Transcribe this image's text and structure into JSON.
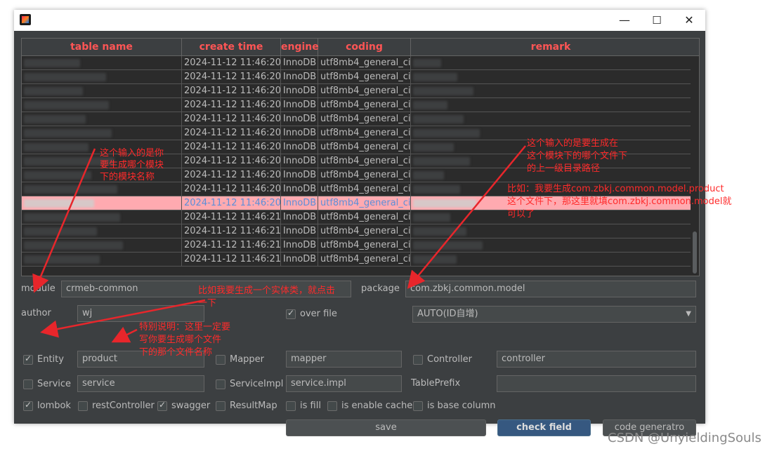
{
  "window": {
    "minimize": "—",
    "maximize": "☐",
    "close": "✕"
  },
  "table": {
    "columns": [
      "table name",
      "create time",
      "engine",
      "coding",
      "remark"
    ],
    "rows": [
      {
        "create_time": "2024-11-12 11:46:20",
        "engine": "InnoDB",
        "coding": "utf8mb4_general_ci"
      },
      {
        "create_time": "2024-11-12 11:46:20",
        "engine": "InnoDB",
        "coding": "utf8mb4_general_ci"
      },
      {
        "create_time": "2024-11-12 11:46:20",
        "engine": "InnoDB",
        "coding": "utf8mb4_general_ci"
      },
      {
        "create_time": "2024-11-12 11:46:20",
        "engine": "InnoDB",
        "coding": "utf8mb4_general_ci"
      },
      {
        "create_time": "2024-11-12 11:46:20",
        "engine": "InnoDB",
        "coding": "utf8mb4_general_ci"
      },
      {
        "create_time": "2024-11-12 11:46:20",
        "engine": "InnoDB",
        "coding": "utf8mb4_general_ci"
      },
      {
        "create_time": "2024-11-12 11:46:20",
        "engine": "InnoDB",
        "coding": "utf8mb4_general_ci"
      },
      {
        "create_time": "2024-11-12 11:46:20",
        "engine": "InnoDB",
        "coding": "utf8mb4_general_ci"
      },
      {
        "create_time": "2024-11-12 11:46:20",
        "engine": "InnoDB",
        "coding": "utf8mb4_general_ci"
      },
      {
        "create_time": "2024-11-12 11:46:20",
        "engine": "InnoDB",
        "coding": "utf8mb4_general_ci"
      },
      {
        "create_time": "2024-11-12 11:46:20",
        "engine": "InnoDB",
        "coding": "utf8mb4_general_ci"
      },
      {
        "create_time": "2024-11-12 11:46:21",
        "engine": "InnoDB",
        "coding": "utf8mb4_general_ci"
      },
      {
        "create_time": "2024-11-12 11:46:21",
        "engine": "InnoDB",
        "coding": "utf8mb4_general_ci"
      },
      {
        "create_time": "2024-11-12 11:46:21",
        "engine": "InnoDB",
        "coding": "utf8mb4_general_ci"
      },
      {
        "create_time": "2024-11-12 11:46:21",
        "engine": "InnoDB",
        "coding": "utf8mb4_general_ci"
      }
    ]
  },
  "form": {
    "module_label": "module",
    "module_value": "crmeb-common",
    "package_label": "package",
    "package_value": "com.zbkj.common.model",
    "author_label": "author",
    "author_value": "wj",
    "over_file_label": "over file",
    "id_type_value": "AUTO(ID自增)",
    "entity_label": "Entity",
    "entity_value": "product",
    "mapper_label": "Mapper",
    "mapper_value": "mapper",
    "controller_label": "Controller",
    "controller_value": "controller",
    "service_label": "Service",
    "service_value": "service",
    "serviceimpl_label": "ServiceImpl",
    "serviceimpl_value": "service.impl",
    "tableprefix_label": "TablePrefix",
    "tableprefix_value": "",
    "lombok_label": "lombok",
    "restcontroller_label": "restController",
    "swagger_label": "swagger",
    "resultmap_label": "ResultMap",
    "isfill_label": "is fill",
    "isenablecache_label": "is enable cache",
    "isbasecolumn_label": "is base column",
    "save_label": "save",
    "checkfield_label": "check field",
    "codegen_label": "code generatro"
  },
  "annotations": {
    "module_note_1": "这个输入的是你",
    "module_note_2": "要生成哪个模块",
    "module_note_3": "下的模块名称",
    "package_note_1": "这个输入的是要生成在",
    "package_note_2": "这个模块下的哪个文件下",
    "package_note_3": "的上一级目录路径",
    "example_note_1": "比如：我要生成com.zbkj.common.model.product",
    "example_note_2": "这个文件下，那这里就填com.zbkj.common.model就",
    "example_note_3": "可以了",
    "entity_click_note_1": "比如我要生成一个实体类，就点击",
    "entity_click_note_2": "一下",
    "entity_value_note_1": "特别说明：这里一定要",
    "entity_value_note_2": "写你要生成哪个文件",
    "entity_value_note_3": "下的那个文件名称"
  },
  "watermark": "CSDN @UnyieldingSouls",
  "colors": {
    "header_text": "#ff5555",
    "annotation": "#ff2b2b",
    "selected_row": "#ffaab0",
    "window_bg": "#3c3f41",
    "primary_button": "#365880"
  }
}
